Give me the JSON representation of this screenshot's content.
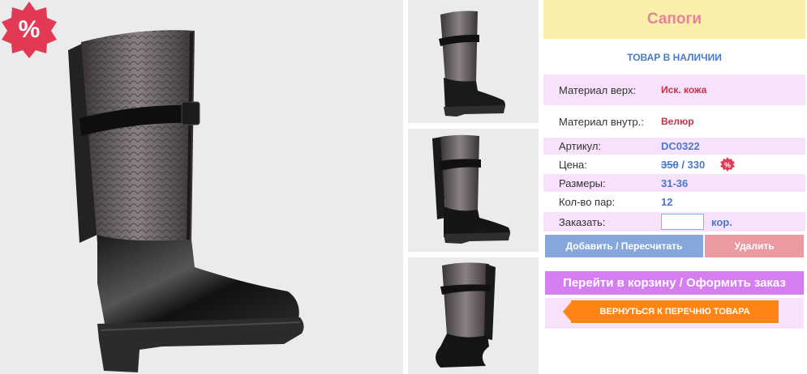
{
  "product": {
    "title": "Сапоги",
    "stock_status": "ТОВАР В НАЛИЧИИ"
  },
  "details": {
    "material_outer_label": "Материал верх:",
    "material_outer_value": "Иск. кожа",
    "material_inner_label": "Материал внутр.:",
    "material_inner_value": "Велюр",
    "article_label": "Артикул:",
    "article_value": "DC0322",
    "price_label": "Цена:",
    "price_old": "350",
    "price_separator": " / ",
    "price_new": "330",
    "sizes_label": "Размеры:",
    "sizes_value": "31-36",
    "pairs_label": "Кол-во пар:",
    "pairs_value": "12",
    "order_label": "Заказать:",
    "order_value": "",
    "order_unit": "кор."
  },
  "actions": {
    "add_label": "Добавить / Пересчитать",
    "delete_label": "Удалить",
    "cart_label": "Перейти в корзину / Оформить заказ",
    "back_label": "ВЕРНУТЬСЯ К ПЕРЕЧНЮ ТОВАРА"
  },
  "badges": {
    "discount_symbol": "%"
  },
  "colors": {
    "title_bg": "#f9efa8",
    "title_text": "#e8829a",
    "accent_blue": "#4a79c9",
    "row_pink": "#f7e1fb",
    "add_button": "#86a7dc",
    "delete_button": "#ea9aa0",
    "cart_button": "#d67ef0",
    "back_button": "#ff8416",
    "discount_red": "#e23a55"
  },
  "icons": [
    "discount-percent-icon",
    "price-discount-icon",
    "back-arrow-icon"
  ]
}
